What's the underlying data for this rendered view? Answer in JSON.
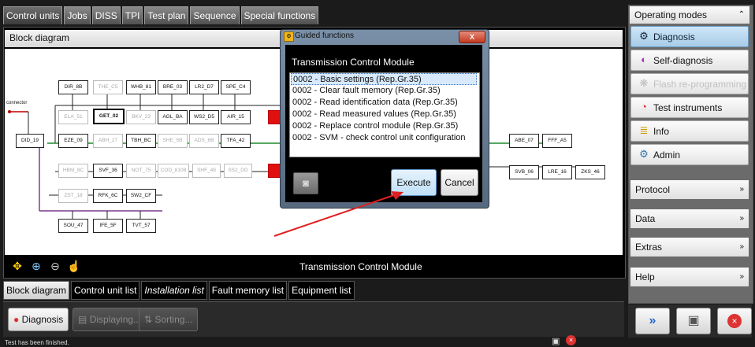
{
  "top_tabs": [
    "Control units",
    "Jobs",
    "DISS",
    "TPI",
    "Test plan",
    "Sequence",
    "Special functions"
  ],
  "block_diagram": {
    "title": "Block diagram",
    "connector_label": "connector",
    "footer_label": "Transmission Control Module",
    "nodes": {
      "dir": "DIR_8B",
      "the": "THE_C5",
      "whb": "WHB_81",
      "bre": "BRE_03",
      "lr2": "LR2_D7",
      "spe": "SPE_C4",
      "ela": "ELA_51",
      "get": "GET_02",
      "bkv": "BKV_23",
      "agl": "AGL_BA",
      "ws2": "WS2_D5",
      "air": "AIR_15",
      "did": "DID_19",
      "eze": "EZE_09",
      "abh": "ABH_27",
      "tbh": "TBH_BC",
      "she": "SHE_5B",
      "ads": "ADS_6B",
      "tfa": "TFA_42",
      "hbm": "HBM_8C",
      "svf": "SVF_36",
      "nos": "NOT_75",
      "cod": "COD_8108",
      "shf": "SHF_48",
      "ss2": "SS2_DD",
      "zst": "ZST_18",
      "rfk": "RFK_6C",
      "sw2": "SW2_CF",
      "sou": "SOU_47",
      "ife": "IFE_5F",
      "tvt": "TVT_57",
      "abe": "ABE_07",
      "fff": "FFF_A5",
      "svb": "SVB_06",
      "lre": "LRE_16",
      "zks": "ZKS_46"
    }
  },
  "bottom_tabs": [
    "Block diagram",
    "Control unit list",
    "Installation list",
    "Fault memory list",
    "Equipment list"
  ],
  "bottom_buttons": {
    "diagnosis": "Diagnosis",
    "displaying": "Displaying...",
    "sorting": "Sorting..."
  },
  "status_text": "Test has been finished.",
  "right_panel": {
    "header": "Operating modes",
    "modes": [
      "Diagnosis",
      "Self-diagnosis",
      "Flash re-programming",
      "Test instruments",
      "Info",
      "Admin"
    ],
    "sections": [
      "Protocol",
      "Data",
      "Extras",
      "Help"
    ]
  },
  "dialog": {
    "title": "Guided functions",
    "close_label": "X",
    "subtitle": "Transmission Control Module",
    "items": [
      "0002 - Basic settings (Rep.Gr.35)",
      "0002 - Clear fault memory (Rep.Gr.35)",
      "0002 - Read identification data (Rep.Gr.35)",
      "0002 - Read measured values (Rep.Gr.35)",
      "0002 - Replace control module (Rep.Gr.35)",
      "0002 - SVM - check control unit configuration"
    ],
    "execute_label": "Execute",
    "cancel_label": "Cancel"
  },
  "colors": {
    "accent_red": "#e01010",
    "selection": "#d7e9fb",
    "annotation_arrow": "#e02020"
  }
}
